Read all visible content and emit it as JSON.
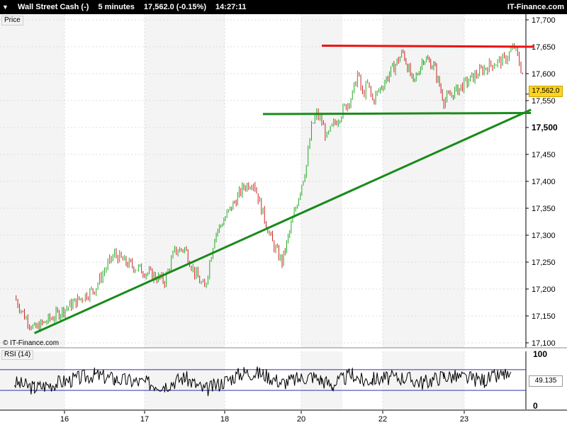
{
  "header": {
    "instrument": "Wall Street Cash (-)",
    "interval": "5 minutes",
    "quote": "17,562.0 (-0.15%)",
    "time": "14:27:11",
    "brand": "IT-Finance.com"
  },
  "price_panel_label": "Price",
  "rsi_panel_label": "RSI (14)",
  "watermark": "© IT-Finance.com",
  "current_price_label": "17,562.0",
  "rsi_value_label": "49.135",
  "colors": {
    "background": "#ffffff",
    "band": "#f4f4f4",
    "grid": "#dddddd",
    "up_candle": "#22aa22",
    "down_candle": "#cc2222",
    "trendline": "#1a8a1a",
    "resistance": "#ee1111",
    "rsi_line": "#000000",
    "rsi_levels": "#3333aa",
    "current_tag": "#ffd21e"
  },
  "chart_data": [
    {
      "type": "line",
      "title": "Wall Street Cash (-) 5 minutes",
      "ylabel": "Price",
      "ylim": [
        17100,
        17700
      ],
      "y_ticks": [
        "17,700",
        "17,650",
        "17,600",
        "17,550",
        "17,500",
        "17,450",
        "17,400",
        "17,350",
        "17,300",
        "17,250",
        "17,200",
        "17,150",
        "17,100"
      ],
      "x_ticks": [
        "16",
        "17",
        "18",
        "20",
        "22",
        "23"
      ],
      "series": [
        {
          "x": [
            "15 09:00",
            "15 12:00",
            "15 15:00",
            "16 09:00",
            "16 12:00",
            "16 15:00",
            "16 18:00",
            "17 06:00",
            "17 09:00",
            "17 12:00",
            "17 15:00",
            "17 18:00",
            "17 21:00",
            "18 06:00",
            "18 09:00",
            "18 12:00",
            "18 15:00",
            "18 18:00",
            "20 03:00",
            "20 06:00",
            "20 09:00",
            "20 12:00",
            "20 15:00",
            "20 18:00",
            "21 06:00",
            "21 09:00",
            "21 12:00",
            "21 15:00",
            "21 18:00",
            "22 06:00",
            "22 09:00",
            "22 12:00",
            "22 15:00",
            "22 18:00",
            "23 06:00",
            "23 09:00",
            "23 12:00",
            "23 15:00",
            "23 18:00",
            "23 20:00"
          ],
          "values": [
            17185,
            17150,
            17125,
            17200,
            17235,
            17265,
            17250,
            17215,
            17270,
            17275,
            17230,
            17200,
            17300,
            17390,
            17400,
            17340,
            17285,
            17250,
            17430,
            17500,
            17525,
            17510,
            17480,
            17500,
            17560,
            17600,
            17560,
            17580,
            17550,
            17640,
            17580,
            17630,
            17615,
            17550,
            17610,
            17620,
            17625,
            17650,
            17590,
            17562
          ]
        }
      ],
      "annotations": [
        {
          "type": "support_trendline",
          "from": {
            "x": "15 15:00",
            "y": 17118
          },
          "to": {
            "x": "23 20:00",
            "y": 17533
          }
        },
        {
          "type": "horizontal_support",
          "from": {
            "x": "18 12:00",
            "y": 17525
          },
          "to": {
            "x": "23 20:00",
            "y": 17527
          }
        },
        {
          "type": "resistance",
          "from": {
            "x": "20 12:00",
            "y": 17652
          },
          "to": {
            "x": "23 21:00",
            "y": 17650
          }
        }
      ],
      "last_price": 17562.0,
      "grid": true
    },
    {
      "type": "line",
      "title": "RSI (14)",
      "ylim": [
        0,
        100
      ],
      "y_ticks": [
        "100",
        "0"
      ],
      "levels": [
        70,
        30
      ],
      "last_value": 49.135,
      "series": [
        {
          "x": [
            "15 09:00",
            "15 15:00",
            "16 09:00",
            "16 15:00",
            "17 06:00",
            "17 12:00",
            "17 18:00",
            "18 06:00",
            "18 12:00",
            "18 18:00",
            "20 06:00",
            "20 12:00",
            "20 18:00",
            "21 06:00",
            "21 12:00",
            "21 18:00",
            "22 06:00",
            "22 12:00",
            "22 18:00",
            "23 06:00",
            "23 12:00",
            "23 18:00",
            "23 20:00"
          ],
          "values": [
            45,
            35,
            60,
            52,
            40,
            55,
            30,
            65,
            62,
            45,
            58,
            50,
            40,
            62,
            48,
            52,
            55,
            45,
            58,
            50,
            60,
            35,
            49.135
          ]
        }
      ]
    }
  ]
}
